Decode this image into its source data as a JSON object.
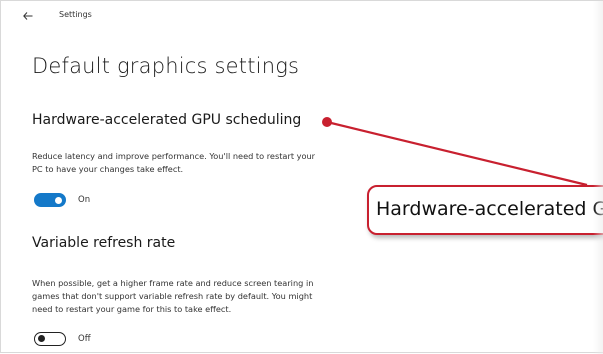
{
  "window": {
    "title": "Settings",
    "back_icon": "back-arrow-icon"
  },
  "page": {
    "title": "Default graphics settings"
  },
  "gpu_scheduling": {
    "title": "Hardware-accelerated GPU scheduling",
    "description_line1": "Reduce latency and improve performance. You'll need to restart your",
    "description_line2": "PC to have your changes take effect.",
    "toggle_state": "On",
    "enabled": true
  },
  "variable_refresh": {
    "title": "Variable refresh rate",
    "description_line1": "When possible, get a higher frame rate and reduce screen tearing in",
    "description_line2": "games that don't support variable refresh rate by default. You might",
    "description_line3": "need to restart your game for this to take effect.",
    "toggle_state": "Off",
    "enabled": false
  },
  "callout": {
    "text": "Hardware-accelerated GPU scheduling",
    "accent_color": "#c8202f"
  },
  "colors": {
    "toggle_on": "#1479c9",
    "toggle_off_border": "#222222"
  }
}
